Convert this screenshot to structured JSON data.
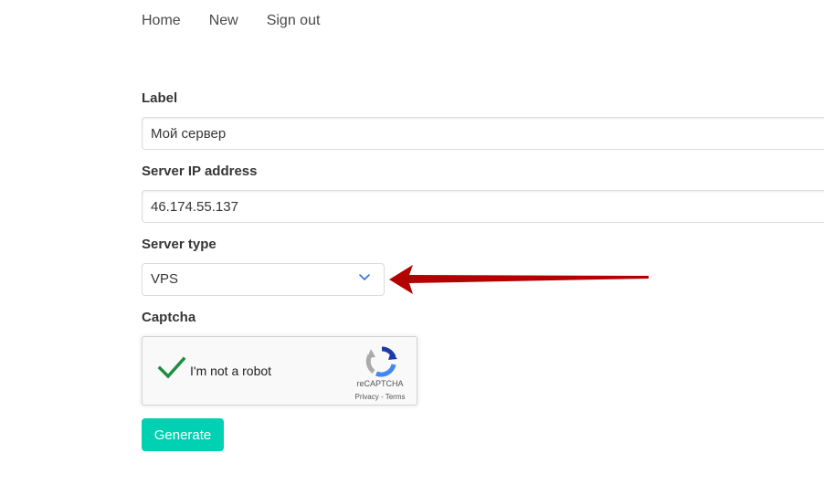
{
  "nav": {
    "items": [
      {
        "label": "Home"
      },
      {
        "label": "New"
      },
      {
        "label": "Sign out"
      }
    ]
  },
  "form": {
    "label_field": {
      "label": "Label",
      "value": "Мой сервер"
    },
    "ip_field": {
      "label": "Server IP address",
      "value": "46.174.55.137"
    },
    "type_field": {
      "label": "Server type",
      "selected": "VPS"
    },
    "captcha": {
      "label": "Captcha",
      "checkbox_text": "I'm not a robot",
      "brand": "reCAPTCHA",
      "privacy": "Privacy",
      "separator": " - ",
      "terms": "Terms",
      "checked": true
    },
    "submit_label": "Generate"
  },
  "colors": {
    "primary": "#00d1b2",
    "annotation_arrow": "#b30000",
    "check": "#1e8e3e"
  },
  "icons": {
    "dropdown": "chevron-down-icon",
    "annotation": "arrow-left-icon",
    "captcha_check": "checkmark-icon",
    "captcha_logo": "recaptcha-logo-icon"
  }
}
